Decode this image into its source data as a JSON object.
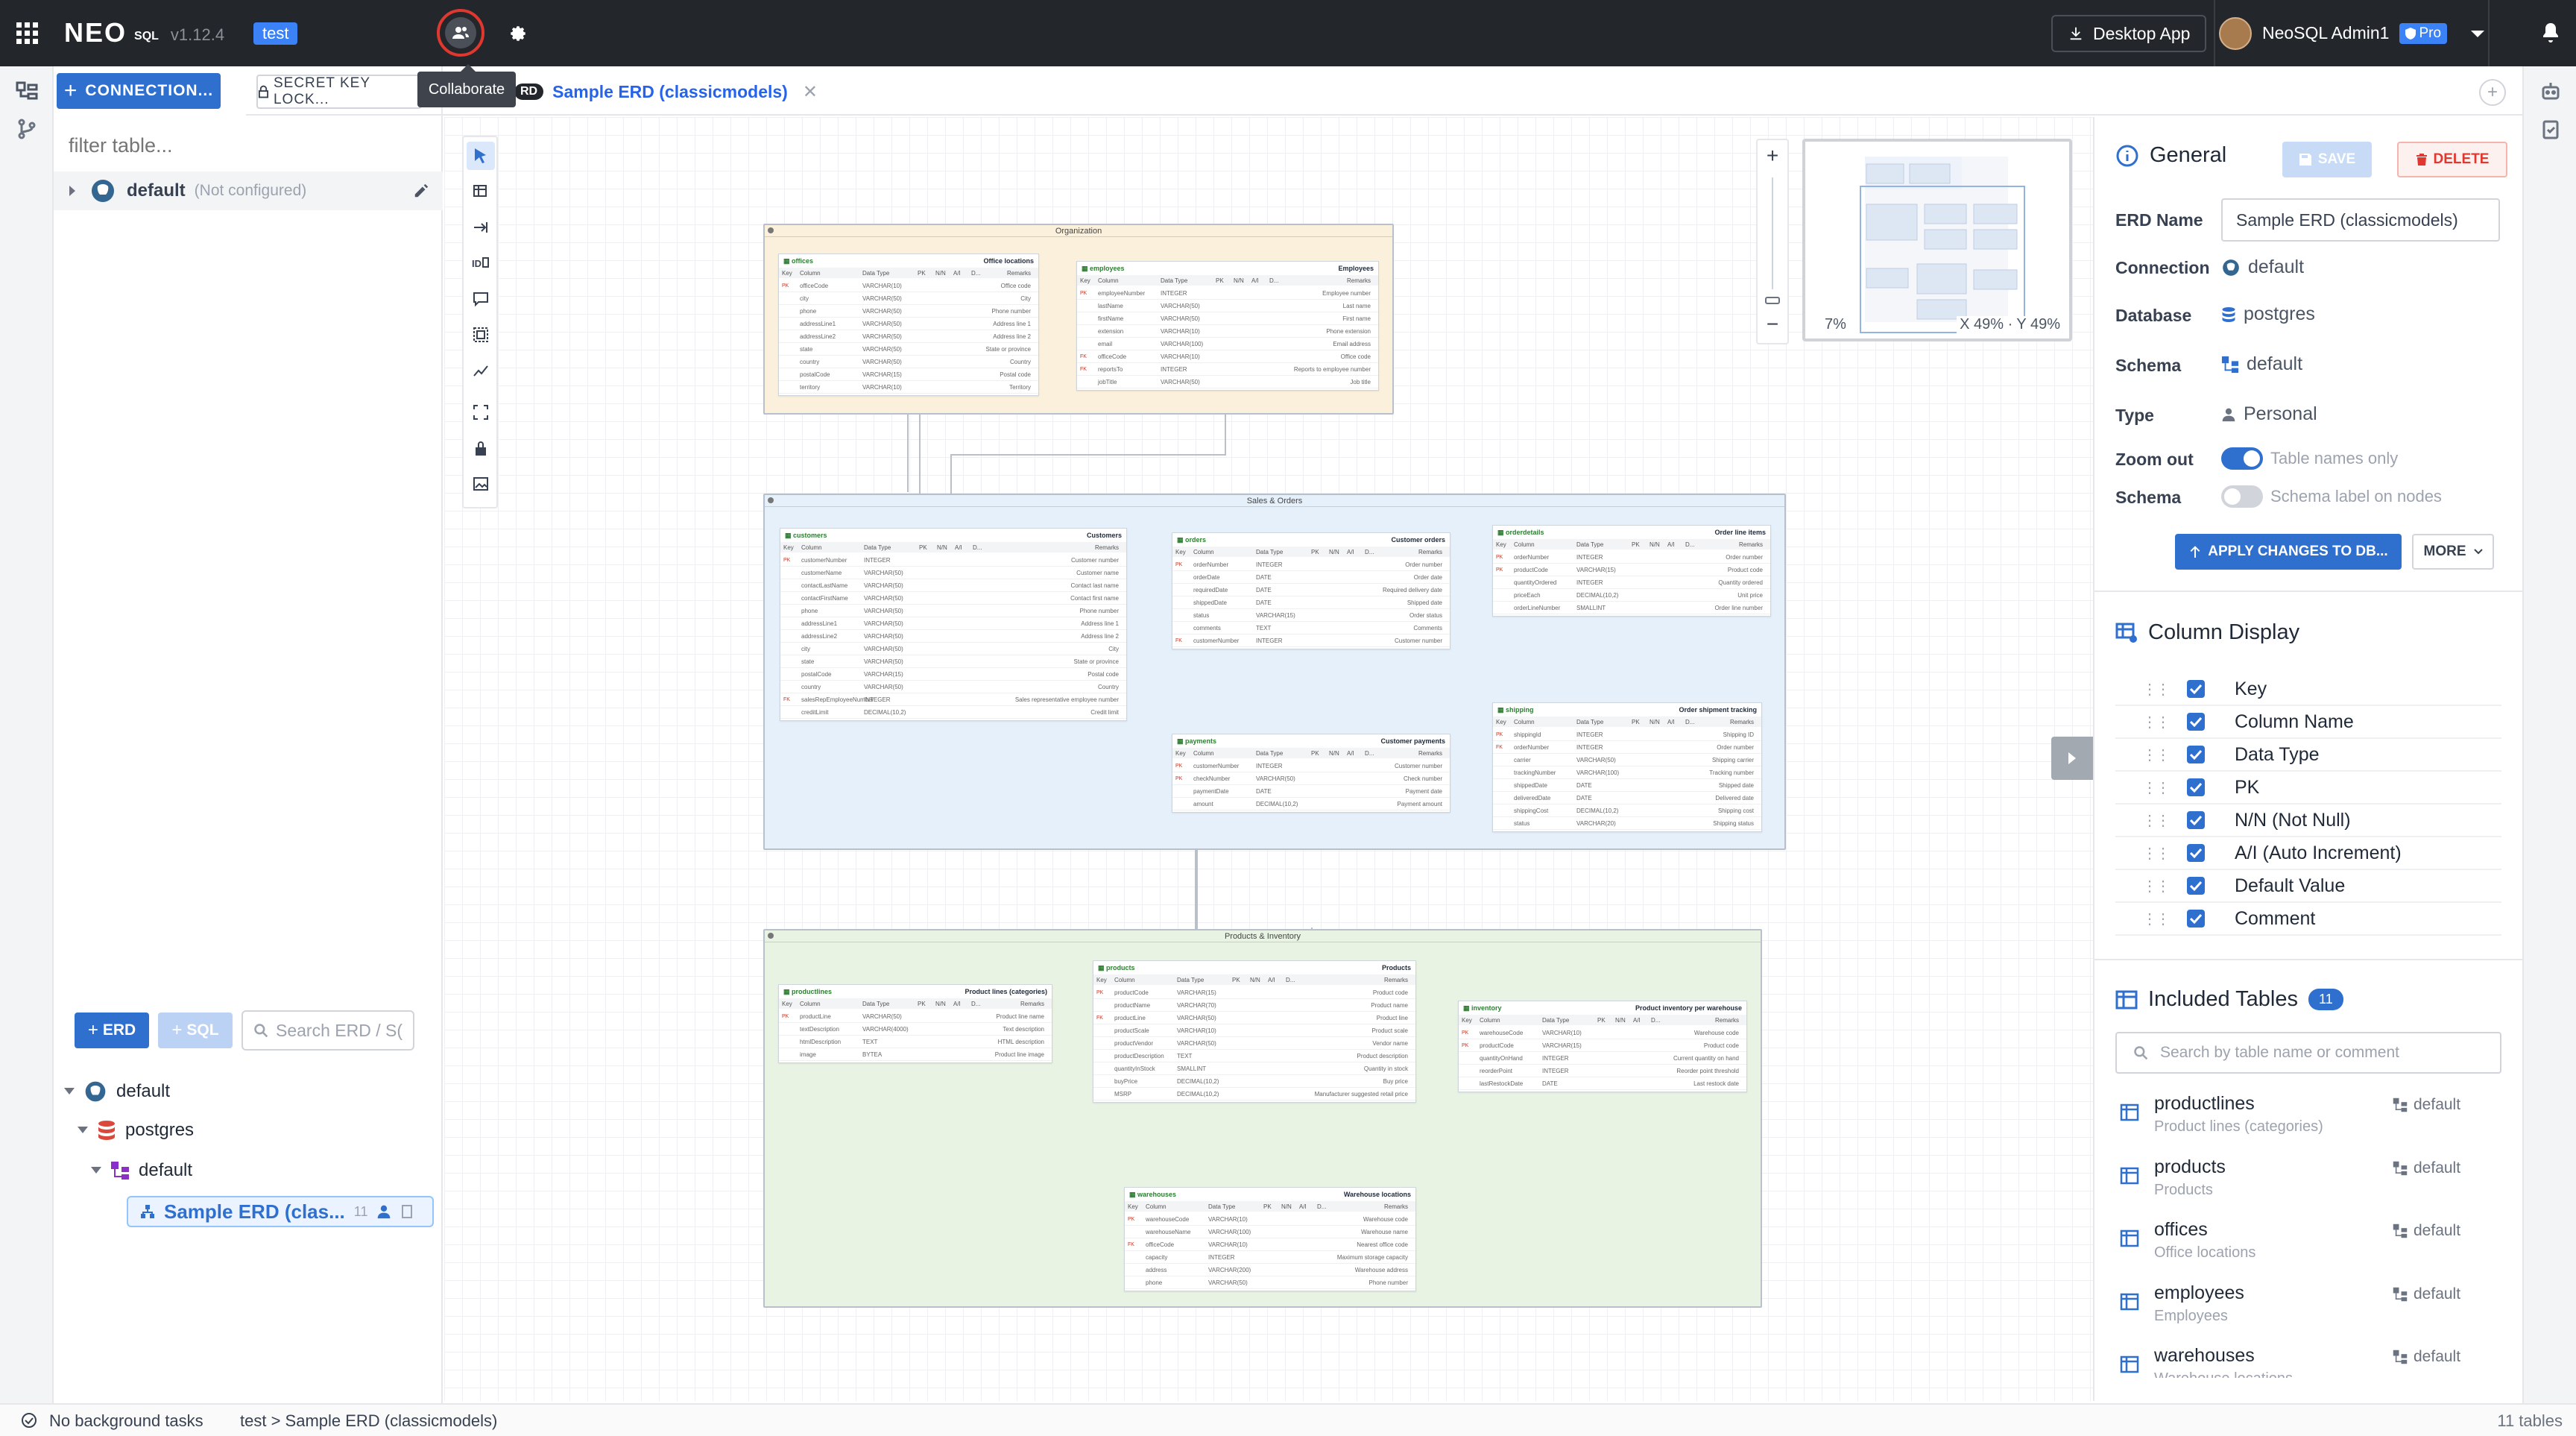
{
  "topbar": {
    "logo_text": "NEO",
    "logo_suffix": "SQL",
    "version": "v1.12.4",
    "env_badge": "test",
    "desktop_app_label": "Desktop App",
    "user_name": "NeoSQL Admin1",
    "pro_badge": "Pro"
  },
  "tooltip": "Collaborate",
  "left_panel": {
    "connection_button": "CONNECTION...",
    "secret_key_button": "SECRET KEY LOCK...",
    "filter_placeholder": "filter table...",
    "connection": {
      "name": "default",
      "status": "(Not configured)"
    },
    "erd_button": "ERD",
    "sql_button": "SQL",
    "search_placeholder": "Search ERD / S(",
    "tree": {
      "connection": "default",
      "database": "postgres",
      "schema": "default",
      "erd_item": "Sample ERD (clas...",
      "erd_count": "11"
    }
  },
  "tab": {
    "label": "Sample ERD (classicmodels)",
    "prefix": "RD"
  },
  "canvas": {
    "minimap_zoom": "7%",
    "minimap_coords": "X 49% · Y 49%",
    "groups": [
      {
        "title": "Organization"
      },
      {
        "title": "Sales & Orders"
      },
      {
        "title": "Products & Inventory"
      }
    ],
    "tables": [
      {
        "name": "offices",
        "comment": "Office locations",
        "rows": [
          [
            "PK",
            "officeCode",
            "VARCHAR(10)",
            "Office code"
          ],
          [
            "",
            "city",
            "VARCHAR(50)",
            "City"
          ],
          [
            "",
            "phone",
            "VARCHAR(50)",
            "Phone number"
          ],
          [
            "",
            "addressLine1",
            "VARCHAR(50)",
            "Address line 1"
          ],
          [
            "",
            "addressLine2",
            "VARCHAR(50)",
            "Address line 2"
          ],
          [
            "",
            "state",
            "VARCHAR(50)",
            "State or province"
          ],
          [
            "",
            "country",
            "VARCHAR(50)",
            "Country"
          ],
          [
            "",
            "postalCode",
            "VARCHAR(15)",
            "Postal code"
          ],
          [
            "",
            "territory",
            "VARCHAR(10)",
            "Territory"
          ]
        ]
      },
      {
        "name": "employees",
        "comment": "Employees",
        "rows": [
          [
            "PK",
            "employeeNumber",
            "INTEGER",
            "Employee number"
          ],
          [
            "",
            "lastName",
            "VARCHAR(50)",
            "Last name"
          ],
          [
            "",
            "firstName",
            "VARCHAR(50)",
            "First name"
          ],
          [
            "",
            "extension",
            "VARCHAR(10)",
            "Phone extension"
          ],
          [
            "",
            "email",
            "VARCHAR(100)",
            "Email address"
          ],
          [
            "FK",
            "officeCode",
            "VARCHAR(10)",
            "Office code"
          ],
          [
            "FK",
            "reportsTo",
            "INTEGER",
            "Reports to employee number"
          ],
          [
            "",
            "jobTitle",
            "VARCHAR(50)",
            "Job title"
          ]
        ]
      },
      {
        "name": "customers",
        "comment": "Customers",
        "rows": [
          [
            "PK",
            "customerNumber",
            "INTEGER",
            "Customer number"
          ],
          [
            "",
            "customerName",
            "VARCHAR(50)",
            "Customer name"
          ],
          [
            "",
            "contactLastName",
            "VARCHAR(50)",
            "Contact last name"
          ],
          [
            "",
            "contactFirstName",
            "VARCHAR(50)",
            "Contact first name"
          ],
          [
            "",
            "phone",
            "VARCHAR(50)",
            "Phone number"
          ],
          [
            "",
            "addressLine1",
            "VARCHAR(50)",
            "Address line 1"
          ],
          [
            "",
            "addressLine2",
            "VARCHAR(50)",
            "Address line 2"
          ],
          [
            "",
            "city",
            "VARCHAR(50)",
            "City"
          ],
          [
            "",
            "state",
            "VARCHAR(50)",
            "State or province"
          ],
          [
            "",
            "postalCode",
            "VARCHAR(15)",
            "Postal code"
          ],
          [
            "",
            "country",
            "VARCHAR(50)",
            "Country"
          ],
          [
            "FK",
            "salesRepEmployeeNumber",
            "INTEGER",
            "Sales representative employee number"
          ],
          [
            "",
            "creditLimit",
            "DECIMAL(10,2)",
            "Credit limit"
          ]
        ]
      },
      {
        "name": "orders",
        "comment": "Customer orders",
        "rows": [
          [
            "PK",
            "orderNumber",
            "INTEGER",
            "Order number"
          ],
          [
            "",
            "orderDate",
            "DATE",
            "Order date"
          ],
          [
            "",
            "requiredDate",
            "DATE",
            "Required delivery date"
          ],
          [
            "",
            "shippedDate",
            "DATE",
            "Shipped date"
          ],
          [
            "",
            "status",
            "VARCHAR(15)",
            "Order status"
          ],
          [
            "",
            "comments",
            "TEXT",
            "Comments"
          ],
          [
            "FK",
            "customerNumber",
            "INTEGER",
            "Customer number"
          ]
        ]
      },
      {
        "name": "orderdetails",
        "comment": "Order line items",
        "rows": [
          [
            "PK",
            "orderNumber",
            "INTEGER",
            "Order number"
          ],
          [
            "PK",
            "productCode",
            "VARCHAR(15)",
            "Product code"
          ],
          [
            "",
            "quantityOrdered",
            "INTEGER",
            "Quantity ordered"
          ],
          [
            "",
            "priceEach",
            "DECIMAL(10,2)",
            "Unit price"
          ],
          [
            "",
            "orderLineNumber",
            "SMALLINT",
            "Order line number"
          ]
        ]
      },
      {
        "name": "payments",
        "comment": "Customer payments",
        "rows": [
          [
            "PK",
            "customerNumber",
            "INTEGER",
            "Customer number"
          ],
          [
            "PK",
            "checkNumber",
            "VARCHAR(50)",
            "Check number"
          ],
          [
            "",
            "paymentDate",
            "DATE",
            "Payment date"
          ],
          [
            "",
            "amount",
            "DECIMAL(10,2)",
            "Payment amount"
          ]
        ]
      },
      {
        "name": "shipping",
        "comment": "Order shipment tracking",
        "rows": [
          [
            "PK",
            "shippingId",
            "INTEGER",
            "Shipping ID"
          ],
          [
            "FK",
            "orderNumber",
            "INTEGER",
            "Order number"
          ],
          [
            "",
            "carrier",
            "VARCHAR(50)",
            "Shipping carrier"
          ],
          [
            "",
            "trackingNumber",
            "VARCHAR(100)",
            "Tracking number"
          ],
          [
            "",
            "shippedDate",
            "DATE",
            "Shipped date"
          ],
          [
            "",
            "deliveredDate",
            "DATE",
            "Delivered date"
          ],
          [
            "",
            "shippingCost",
            "DECIMAL(10,2)",
            "Shipping cost"
          ],
          [
            "",
            "status",
            "VARCHAR(20)",
            "Shipping status"
          ]
        ]
      },
      {
        "name": "productlines",
        "comment": "Product lines (categories)",
        "rows": [
          [
            "PK",
            "productLine",
            "VARCHAR(50)",
            "Product line name"
          ],
          [
            "",
            "textDescription",
            "VARCHAR(4000)",
            "Text description"
          ],
          [
            "",
            "htmlDescription",
            "TEXT",
            "HTML description"
          ],
          [
            "",
            "image",
            "BYTEA",
            "Product line image"
          ]
        ]
      },
      {
        "name": "products",
        "comment": "Products",
        "rows": [
          [
            "PK",
            "productCode",
            "VARCHAR(15)",
            "Product code"
          ],
          [
            "",
            "productName",
            "VARCHAR(70)",
            "Product name"
          ],
          [
            "FK",
            "productLine",
            "VARCHAR(50)",
            "Product line"
          ],
          [
            "",
            "productScale",
            "VARCHAR(10)",
            "Product scale"
          ],
          [
            "",
            "productVendor",
            "VARCHAR(50)",
            "Vendor name"
          ],
          [
            "",
            "productDescription",
            "TEXT",
            "Product description"
          ],
          [
            "",
            "quantityInStock",
            "SMALLINT",
            "Quantity in stock"
          ],
          [
            "",
            "buyPrice",
            "DECIMAL(10,2)",
            "Buy price"
          ],
          [
            "",
            "MSRP",
            "DECIMAL(10,2)",
            "Manufacturer suggested retail price"
          ]
        ]
      },
      {
        "name": "inventory",
        "comment": "Product inventory per warehouse",
        "rows": [
          [
            "PK",
            "warehouseCode",
            "VARCHAR(10)",
            "Warehouse code"
          ],
          [
            "PK",
            "productCode",
            "VARCHAR(15)",
            "Product code"
          ],
          [
            "",
            "quantityOnHand",
            "INTEGER",
            "Current quantity on hand"
          ],
          [
            "",
            "reorderPoint",
            "INTEGER",
            "Reorder point threshold"
          ],
          [
            "",
            "lastRestockDate",
            "DATE",
            "Last restock date"
          ]
        ]
      },
      {
        "name": "warehouses",
        "comment": "Warehouse locations",
        "rows": [
          [
            "PK",
            "warehouseCode",
            "VARCHAR(10)",
            "Warehouse code"
          ],
          [
            "",
            "warehouseName",
            "VARCHAR(100)",
            "Warehouse name"
          ],
          [
            "FK",
            "officeCode",
            "VARCHAR(10)",
            "Nearest office code"
          ],
          [
            "",
            "capacity",
            "INTEGER",
            "Maximum storage capacity"
          ],
          [
            "",
            "address",
            "VARCHAR(200)",
            "Warehouse address"
          ],
          [
            "",
            "phone",
            "VARCHAR(50)",
            "Phone number"
          ]
        ]
      }
    ],
    "column_header": [
      "Key",
      "Column",
      "Data Type",
      "PK",
      "N/N",
      "A/I",
      "D...",
      "Remarks"
    ]
  },
  "right_panel": {
    "general_title": "General",
    "save_label": "SAVE",
    "delete_label": "DELETE",
    "fields": {
      "erd_name_label": "ERD Name",
      "erd_name_value": "Sample ERD (classicmodels)",
      "connection_label": "Connection",
      "connection_value": "default",
      "database_label": "Database",
      "database_value": "postgres",
      "schema_label": "Schema",
      "schema_value": "default",
      "type_label": "Type",
      "type_value": "Personal",
      "zoom_out_label": "Zoom out",
      "zoom_out_value": "Table names only",
      "zoom_out_on": true,
      "schema_toggle_label": "Schema",
      "schema_toggle_value": "Schema label on nodes",
      "schema_toggle_on": false
    },
    "apply_button": "APPLY CHANGES TO DB...",
    "more_button": "MORE",
    "column_display_title": "Column Display",
    "column_display": [
      {
        "label": "Key",
        "checked": true
      },
      {
        "label": "Column Name",
        "checked": true
      },
      {
        "label": "Data Type",
        "checked": true
      },
      {
        "label": "PK",
        "checked": true
      },
      {
        "label": "N/N (Not Null)",
        "checked": true
      },
      {
        "label": "A/I (Auto Increment)",
        "checked": true
      },
      {
        "label": "Default Value",
        "checked": true
      },
      {
        "label": "Comment",
        "checked": true
      }
    ],
    "included_tables_title": "Included Tables",
    "included_count": "11",
    "included_search_placeholder": "Search by table name or comment",
    "included_tables": [
      {
        "name": "productlines",
        "comment": "Product lines (categories)",
        "schema": "default"
      },
      {
        "name": "products",
        "comment": "Products",
        "schema": "default"
      },
      {
        "name": "offices",
        "comment": "Office locations",
        "schema": "default"
      },
      {
        "name": "employees",
        "comment": "Employees",
        "schema": "default"
      },
      {
        "name": "warehouses",
        "comment": "Warehouse locations",
        "schema": "default"
      }
    ]
  },
  "statusbar": {
    "tasks": "No background tasks",
    "breadcrumb": "test > Sample ERD (classicmodels)",
    "table_count": "11 tables"
  },
  "colors": {
    "accent": "#2f6fce",
    "topbar": "#23262b",
    "org_group": "#fbf0dc",
    "sales_group": "#e6f0fb",
    "products_group": "#e8f3e4",
    "highlight_red": "#e0382f"
  }
}
